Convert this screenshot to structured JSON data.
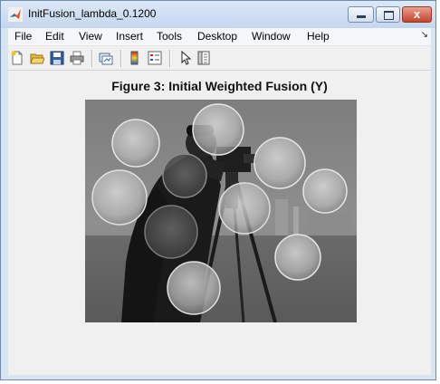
{
  "window": {
    "title": "InitFusion_lambda_0.1200",
    "close_glyph": "x"
  },
  "menubar": {
    "items": [
      "File",
      "Edit",
      "View",
      "Insert",
      "Tools",
      "Desktop",
      "Window",
      "Help"
    ],
    "overflow_glyph": "↘"
  },
  "toolbar": {
    "icons": [
      "new-figure-icon",
      "open-file-icon",
      "save-icon",
      "print-icon",
      "link-plot-icon",
      "colorbar-icon",
      "legend-icon",
      "edit-plot-pointer-icon",
      "property-inspector-icon"
    ]
  },
  "figure": {
    "title": "Figure 3: Initial Weighted Fusion (Y)",
    "content": "fused-image-cameraman-coins"
  }
}
